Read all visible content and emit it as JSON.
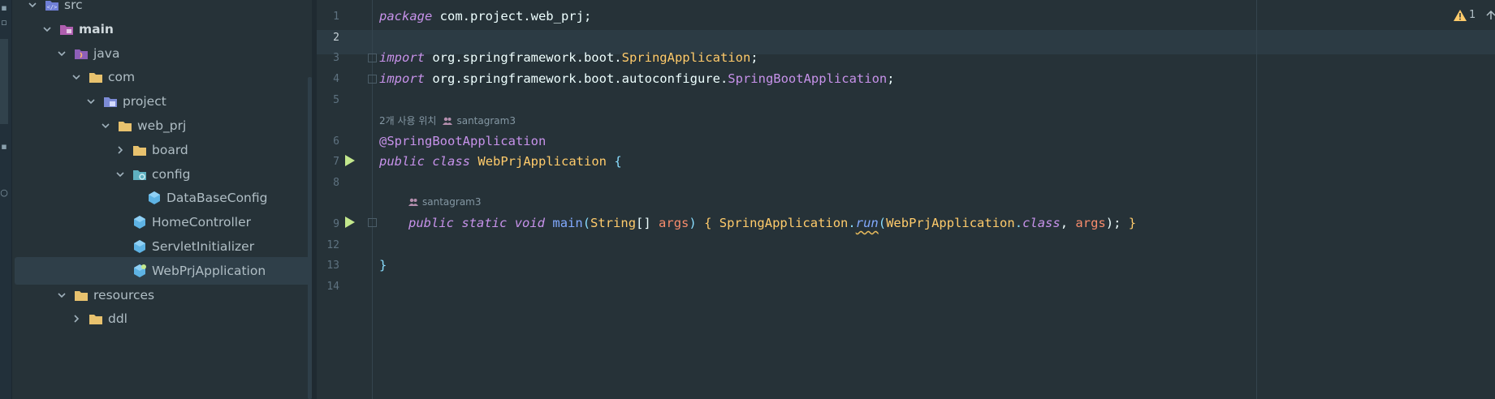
{
  "tree": {
    "items": [
      {
        "label": "src",
        "level": 1,
        "expanded": true,
        "icon": "source-folder-icon"
      },
      {
        "label": "main",
        "level": 2,
        "expanded": true,
        "icon": "module-folder-icon",
        "bold": true
      },
      {
        "label": "java",
        "level": 3,
        "expanded": true,
        "icon": "java-source-folder-icon"
      },
      {
        "label": "com",
        "level": 4,
        "expanded": true,
        "icon": "folder-icon"
      },
      {
        "label": "project",
        "level": 5,
        "expanded": true,
        "icon": "package-folder-icon"
      },
      {
        "label": "web_prj",
        "level": 6,
        "expanded": true,
        "icon": "folder-icon"
      },
      {
        "label": "board",
        "level": 7,
        "expanded": false,
        "icon": "folder-icon"
      },
      {
        "label": "config",
        "level": 7,
        "expanded": true,
        "icon": "config-folder-icon"
      },
      {
        "label": "DataBaseConfig",
        "level": 8,
        "icon": "class-icon"
      },
      {
        "label": "HomeController",
        "level": 7,
        "icon": "class-icon"
      },
      {
        "label": "ServletInitializer",
        "level": 7,
        "icon": "class-icon"
      },
      {
        "label": "WebPrjApplication",
        "level": 7,
        "icon": "spring-class-icon",
        "selected": true
      },
      {
        "label": "resources",
        "level": 3,
        "expanded": true,
        "icon": "resources-folder-icon"
      },
      {
        "label": "ddl",
        "level": 4,
        "expanded": false,
        "icon": "folder-icon"
      }
    ]
  },
  "editor": {
    "line_numbers": [
      "1",
      "2",
      "3",
      "4",
      "5",
      "6",
      "7",
      "8",
      "9",
      "12",
      "13",
      "14"
    ],
    "active_line": "2",
    "hints": {
      "usages": "2개 사용 위치",
      "author1": "santagram3",
      "author2": "santagram3"
    },
    "warning_count": "1",
    "code": {
      "l1_kw": "package",
      "l1_rest": " com.project.web_prj;",
      "l3_kw": "import",
      "l3_rest": " org.springframework.boot.",
      "l3_cls": "SpringApplication",
      "l3_end": ";",
      "l4_kw": "import",
      "l4_rest": " org.springframework.boot.autoconfigure.",
      "l4_cls": "SpringBootApplication",
      "l4_end": ";",
      "l6_ann": "@SpringBootApplication",
      "l7_kw1": "public",
      "l7_kw2": "class",
      "l7_cls": "WebPrjApplication",
      "l7_brace": "{",
      "l9_kw1": "public",
      "l9_kw2": "static",
      "l9_kw3": "void",
      "l9_fn": "main",
      "l9_p1": "(",
      "l9_type": "String",
      "l9_arr": "[]",
      "l9_param": "args",
      "l9_p2": ")",
      "l9_b1": "{",
      "l9_cls1": "SpringApplication",
      "l9_dot1": ".",
      "l9_run": "run",
      "l9_p3": "(",
      "l9_cls2": "WebPrjApplication",
      "l9_dot2": ".",
      "l9_classkw": "class",
      "l9_comma": ", ",
      "l9_args": "args",
      "l9_p4": ");",
      "l9_b2": "}",
      "l13_brace": "}"
    }
  },
  "colors": {
    "background": "#263238",
    "keyword": "#c792ea",
    "class": "#ffcb6b",
    "function": "#82aaff",
    "parameter": "#f78c6c",
    "run_icon": "#c3e88d",
    "warning": "#ffcb6b"
  }
}
